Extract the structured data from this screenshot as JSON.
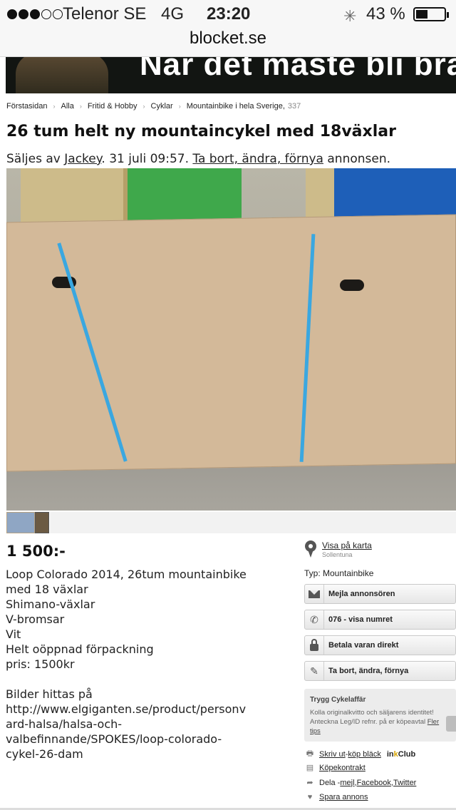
{
  "status_bar": {
    "signal_dots_filled": 3,
    "signal_dots_total": 5,
    "carrier": "Telenor SE",
    "network": "4G",
    "time": "23:20",
    "battery_percent": "43 %",
    "battery_level": 0.43
  },
  "url_bar": {
    "url": "blocket.se"
  },
  "banner": {
    "text": "När det mäste bli bra"
  },
  "breadcrumb": {
    "items": [
      "Förstasidan",
      "Alla",
      "Fritid & Hobby",
      "Cyklar",
      "Mountainbike i hela Sverige,"
    ],
    "count": "337"
  },
  "ad": {
    "title": "26 tum helt ny mountaincykel med 18växlar",
    "seller_prefix": "Säljes av ",
    "seller_name": "Jackey",
    "date": ". 31 juli 09:57. ",
    "edit_link": "Ta bort, ändra, förnya",
    "edit_suffix": " annonsen.",
    "price": "1 500:-",
    "description_lines": [
      "Loop Colorado 2014, 26tum mountainbike",
      "med 18 växlar",
      "Shimano-växlar",
      "V-bromsar",
      "Vit",
      "Helt oöppnad förpackning",
      "pris: 1500kr"
    ],
    "description_lines_2": [
      "Bilder hittas på",
      "http://www.elgiganten.se/product/personv",
      "ard-halsa/halsa-och-",
      "valbefinnande/SPOKES/loop-colorado-",
      "cykel-26-dam"
    ]
  },
  "sidebar": {
    "map_link": "Visa på karta",
    "location": "Sollentuna",
    "type_label": "Typ: Mountainbike",
    "buttons": [
      {
        "label": "Mejla annonsören",
        "icon": "envelope-icon"
      },
      {
        "label": "076 - visa numret",
        "icon": "phone-icon"
      },
      {
        "label": "Betala varan direkt",
        "icon": "lock-icon"
      },
      {
        "label": "Ta bort, ändra, förnya",
        "icon": "pencil-icon"
      }
    ],
    "tips": {
      "heading": "Trygg Cykelaffär",
      "body": "Kolla originalkvitto och säljarens identitet! Anteckna Leg/ID refnr. på er köpeavtal ",
      "link": "Fler tips"
    },
    "actions": {
      "print": "Skriv ut",
      "separator": " - ",
      "buy_ink": "köp bläck",
      "inkclub_prefix": "in",
      "inkclub_k": "k",
      "inkclub_suffix": "Club",
      "contract": "Köpekontrakt",
      "share_prefix": "Dela - ",
      "share_mail": "mejl",
      "comma": ", ",
      "share_facebook": "Facebook",
      "share_twitter": "Twitter",
      "save": "Spara annons"
    }
  },
  "colors": {
    "strap": "#3aa7e0",
    "box": "#d3b999",
    "banner_bg": "#121512"
  }
}
